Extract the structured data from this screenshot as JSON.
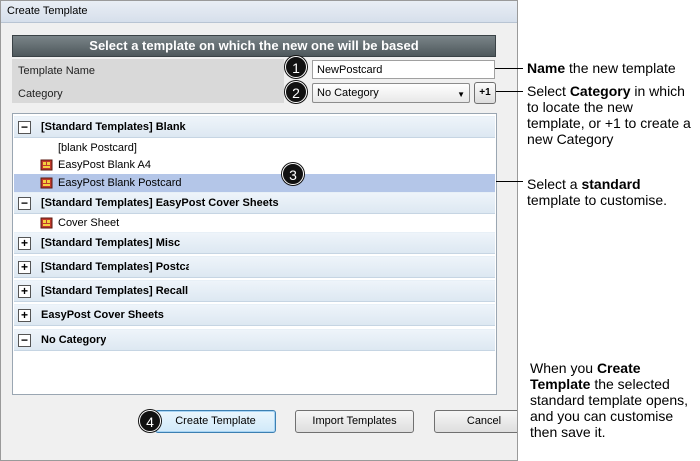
{
  "window": {
    "title": "Create Template"
  },
  "banner": "Select a template on which the new one will be based",
  "form": {
    "name_label": "Template Name",
    "name_value": "NewPostcard",
    "category_label": "Category",
    "category_value": "No Category",
    "add_category_label": "+1"
  },
  "badges": [
    "1",
    "2",
    "3",
    "4"
  ],
  "tree": {
    "groups": [
      {
        "label": "[Standard Templates] Blank",
        "expanded": true,
        "items": [
          {
            "label": "[blank Postcard]",
            "icon": "none"
          },
          {
            "label": "EasyPost Blank A4",
            "icon": "template-icon"
          },
          {
            "label": "EasyPost Blank Postcard",
            "icon": "template-icon",
            "selected": true
          }
        ]
      },
      {
        "label": "[Standard Templates] EasyPost Cover Sheets",
        "expanded": true,
        "items": [
          {
            "label": "Cover Sheet",
            "icon": "template-icon"
          }
        ]
      },
      {
        "label": "[Standard Templates] Misc",
        "expanded": false
      },
      {
        "label": "[Standard Templates] Postcard",
        "expanded": false
      },
      {
        "label": "[Standard Templates] Recall Le",
        "expanded": false
      },
      {
        "label": "EasyPost Cover Sheets",
        "expanded": false
      },
      {
        "label": "No Category",
        "expanded": true
      }
    ]
  },
  "buttons": {
    "create": "Create Template",
    "import": "Import Templates",
    "cancel": "Cancel"
  },
  "annotations": {
    "a1_bold": "Name",
    "a1_rest": " the new template",
    "a2_pre": "Select ",
    "a2_bold": "Category",
    "a2_rest": " in which to locate the new template, or +1 to create a new Category",
    "a3_pre": "Select a ",
    "a3_bold": "standard",
    "a3_rest": " template to  customise.",
    "a4_pre": "When you ",
    "a4_bold": "Create Template",
    "a4_rest": " the selected standard template opens, and you can customise then save it."
  }
}
